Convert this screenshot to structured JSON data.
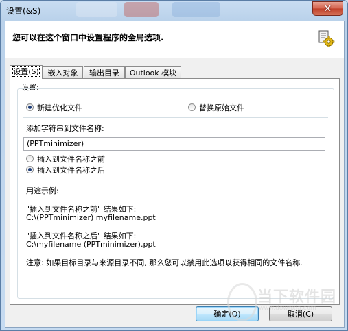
{
  "window": {
    "title": "设置(&S)",
    "close_glyph": "✕"
  },
  "header": {
    "text": "您可以在这个窗口中设置程序的全局选项."
  },
  "tabs": [
    {
      "label": "设置(S)",
      "active": true
    },
    {
      "label": "嵌入对象",
      "active": false
    },
    {
      "label": "输出目录",
      "active": false
    },
    {
      "label": "Outlook 模块",
      "active": false
    }
  ],
  "settings": {
    "group_label": "设置:",
    "output_mode": {
      "options": [
        "新建优化文件",
        "替换原始文件"
      ],
      "selected": "新建优化文件"
    },
    "append_label": "添加字符串到文件名称:",
    "append_value": "(PPTminimizer)",
    "position": {
      "options": [
        "插入到文件名称之前",
        "插入到文件名称之后"
      ],
      "selected": "插入到文件名称之后"
    },
    "example_title": "用途示例:",
    "example_before_label": "\"插入到文件名称之前\" 结果如下:",
    "example_before_value": "C:\\(PPTminimizer) myfilename.ppt",
    "example_after_label": "\"插入到文件名称之后\" 结果如下:",
    "example_after_value": "C:\\myfilename (PPTminimizer).ppt",
    "note": "注意: 如果目标目录与来源目录不同, 那么您可以禁用此选项以获得相同的文件名称."
  },
  "buttons": {
    "ok": "确定(O)",
    "cancel": "取消(C)"
  },
  "watermark": {
    "text": "当下软件园",
    "url": "www.downxia.com"
  }
}
